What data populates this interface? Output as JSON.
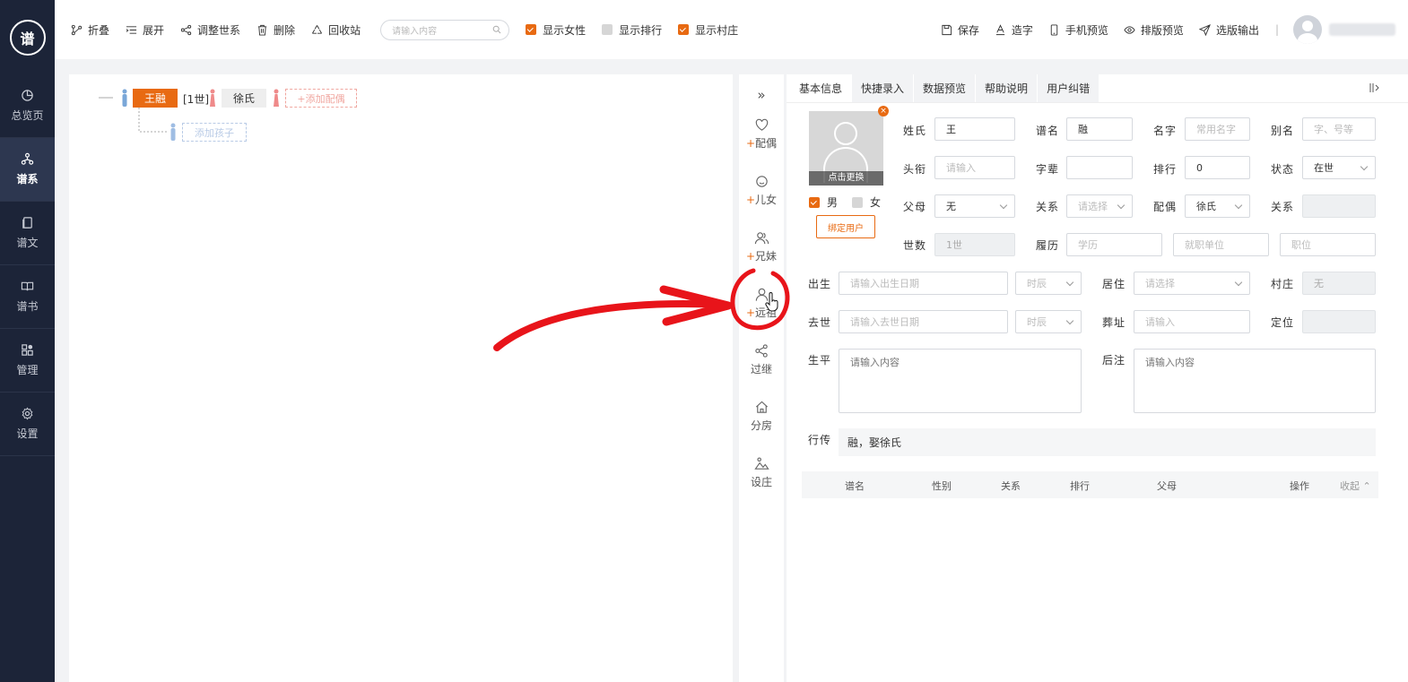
{
  "sidebar": {
    "logo": "谱",
    "items": [
      {
        "label": "总览页",
        "icon": "pie-chart-icon"
      },
      {
        "label": "谱系",
        "icon": "family-tree-icon"
      },
      {
        "label": "谱文",
        "icon": "document-icon"
      },
      {
        "label": "谱书",
        "icon": "book-icon"
      },
      {
        "label": "管理",
        "icon": "grid-icon"
      },
      {
        "label": "设置",
        "icon": "gear-icon"
      }
    ]
  },
  "toolbar": {
    "fold": "折叠",
    "expand": "展开",
    "adjust": "调整世系",
    "delete": "删除",
    "recycle": "回收站",
    "search_placeholder": "请输入内容",
    "show_female": "显示女性",
    "show_rank": "显示排行",
    "show_village": "显示村庄",
    "save": "保存",
    "make_char": "造字",
    "mobile_preview": "手机预览",
    "layout_preview": "排版预览",
    "export": "选版输出",
    "separator": "|"
  },
  "tree": {
    "root_name": "王融",
    "generation": "[1世]",
    "spouse": "徐氏",
    "add_spouse": "+添加配偶",
    "add_child": "添加孩子"
  },
  "tools": {
    "collapse": "»",
    "plus": "+",
    "spouse": "配偶",
    "children": "儿女",
    "siblings": "兄妹",
    "ancestor": "远祖",
    "adopt": "过继",
    "branch": "分房",
    "village": "设庄"
  },
  "tabs": [
    "基本信息",
    "快捷录入",
    "数据预览",
    "帮助说明",
    "用户纠错"
  ],
  "form": {
    "photo_caption": "点击更换",
    "photo_close": "×",
    "male": "男",
    "female": "女",
    "bind_user": "绑定用户",
    "surname_label": "姓氏",
    "surname": "王",
    "puming_label": "谱名",
    "puming": "融",
    "mingzi_label": "名字",
    "mingzi_ph": "常用名字",
    "bieming_label": "别名",
    "bieming_ph": "字、号等",
    "title_label": "头衔",
    "title_ph": "请输入",
    "zibei_label": "字辈",
    "zibei": "",
    "paihang_label": "排行",
    "paihang": "0",
    "status_label": "状态",
    "status": "在世",
    "parents_label": "父母",
    "parents": "无",
    "relation_label": "关系",
    "relation_ph": "请选择",
    "peiou_label": "配偶",
    "peiou": "徐氏",
    "relation2_label": "关系",
    "gen_label": "世数",
    "gen": "1世",
    "resume_label": "履历",
    "edu_ph": "学历",
    "work_ph": "就职单位",
    "post_ph": "职位",
    "birth_label": "出生",
    "birth_ph": "请输入出生日期",
    "shichen_ph": "时辰",
    "live_label": "居住",
    "live_ph": "请选择",
    "village_label": "村庄",
    "village": "无",
    "death_label": "去世",
    "death_ph": "请输入去世日期",
    "shichen2_ph": "时辰",
    "burial_label": "葬址",
    "burial_ph": "请输入",
    "locate_label": "定位",
    "life_label": "生平",
    "life_ph": "请输入内容",
    "note_label": "后注",
    "note_ph": "请输入内容",
    "xingzhuan_label": "行传",
    "xingzhuan": "融，娶徐氏"
  },
  "table": {
    "headers": [
      "谱名",
      "性别",
      "关系",
      "排行",
      "父母",
      "操作"
    ],
    "toggle": "收起 ⌃"
  },
  "colors": {
    "accent": "#e86a12",
    "sidebar": "#1c2438",
    "annotation": "#e8141a"
  }
}
